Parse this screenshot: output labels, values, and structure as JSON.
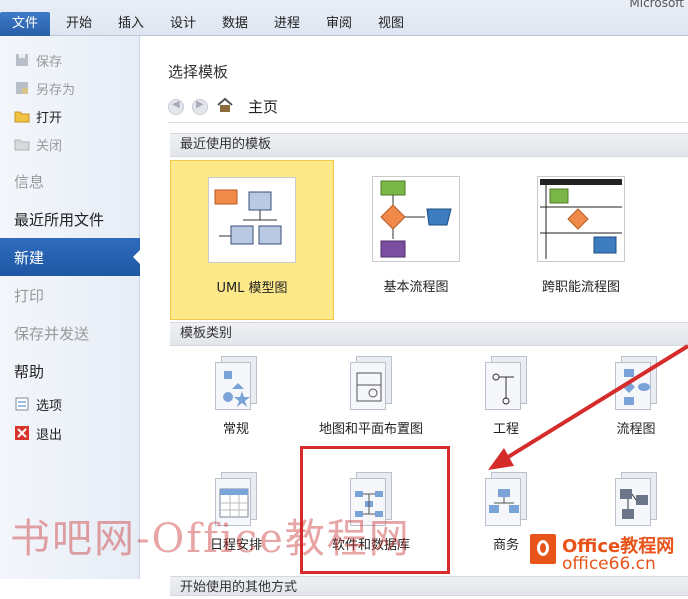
{
  "window": {
    "title": "Microsoft"
  },
  "ribbon": {
    "tabs": [
      "文件",
      "开始",
      "插入",
      "设计",
      "数据",
      "进程",
      "审阅",
      "视图"
    ]
  },
  "nav": {
    "save": "保存",
    "save_as": "另存为",
    "open": "打开",
    "close": "关闭",
    "info": "信息",
    "recent": "最近所用文件",
    "new": "新建",
    "print": "打印",
    "save_send": "保存并发送",
    "help": "帮助",
    "options": "选项",
    "exit": "退出"
  },
  "main": {
    "title": "选择模板",
    "breadcrumb_home": "主页",
    "recent_section": "最近使用的模板",
    "recent_templates": [
      "UML 模型图",
      "基本流程图",
      "跨职能流程图"
    ],
    "category_section": "模板类别",
    "categories_row1": [
      "常规",
      "地图和平面布置图",
      "工程",
      "流程图"
    ],
    "categories_row2": [
      "日程安排",
      "软件和数据库",
      "商务"
    ],
    "next_section": "开始使用的其他方式"
  },
  "watermark": {
    "text": "书吧网-Office教程网",
    "logo_line1": "Office教程网",
    "logo_line2": "office66.cn"
  },
  "colors": {
    "accent": "#2a5fa8",
    "selected_tile": "#fde88a",
    "annotation": "#d62b2b"
  }
}
